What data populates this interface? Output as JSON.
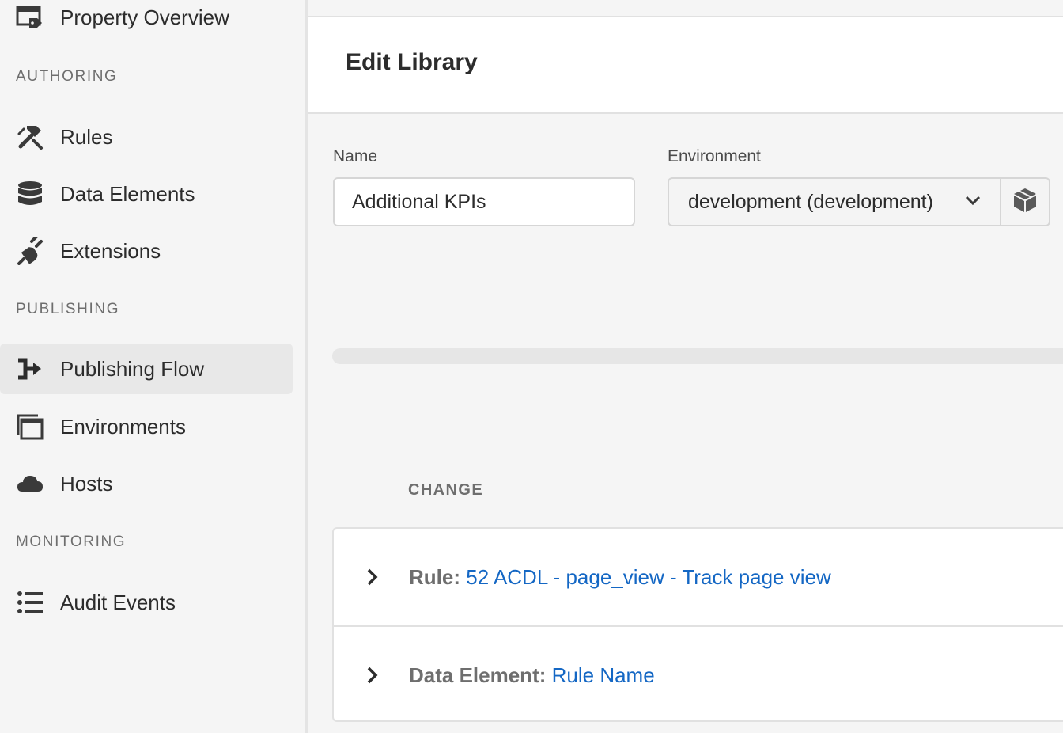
{
  "sidebar": {
    "property_overview": {
      "label": "Property Overview",
      "icon": "property-overview-icon"
    },
    "sections": {
      "authoring": "AUTHORING",
      "publishing": "PUBLISHING",
      "monitoring": "MONITORING"
    },
    "items": [
      {
        "label": "Rules",
        "icon": "rules-icon"
      },
      {
        "label": "Data Elements",
        "icon": "database-icon"
      },
      {
        "label": "Extensions",
        "icon": "plug-icon"
      },
      {
        "label": "Publishing Flow",
        "icon": "publishing-flow-icon",
        "active": true
      },
      {
        "label": "Environments",
        "icon": "environments-icon"
      },
      {
        "label": "Hosts",
        "icon": "cloud-icon"
      },
      {
        "label": "Audit Events",
        "icon": "list-icon"
      }
    ]
  },
  "header": {
    "title": "Edit Library"
  },
  "form": {
    "name_label": "Name",
    "name_value": "Additional KPIs",
    "environment_label": "Environment",
    "environment_value": "development (development)"
  },
  "changes": {
    "column_header": "CHANGE",
    "rows": [
      {
        "kind": "Rule:",
        "name": "52 ACDL - page_view - Track page view"
      },
      {
        "kind": "Data Element:",
        "name": "Rule Name"
      }
    ]
  },
  "colors": {
    "link": "#1467c4",
    "active_nav_bg": "#e8e8e8",
    "text": "#2c2c2c"
  }
}
